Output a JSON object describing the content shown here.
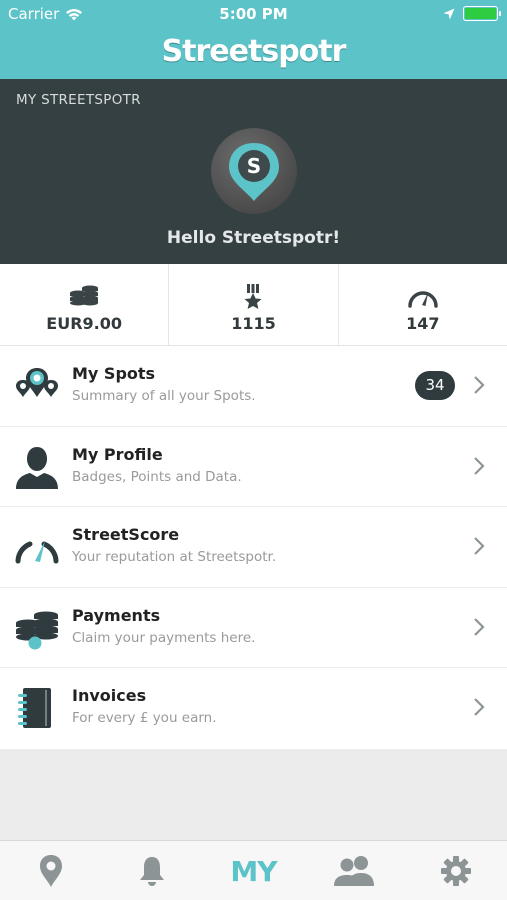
{
  "status_bar": {
    "carrier": "Carrier",
    "time": "5:00 PM"
  },
  "app": {
    "logo_text": "Streetspotr"
  },
  "profile": {
    "section_title": "MY STREETSPOTR",
    "greeting": "Hello Streetspotr!"
  },
  "stats": [
    {
      "icon": "coins-icon",
      "value": "EUR9.00"
    },
    {
      "icon": "medal-icon",
      "value": "1115"
    },
    {
      "icon": "speedometer-icon",
      "value": "147"
    }
  ],
  "menu": [
    {
      "icon": "map-pins-icon",
      "title": "My Spots",
      "subtitle": "Summary of all your Spots.",
      "badge": "34"
    },
    {
      "icon": "person-icon",
      "title": "My Profile",
      "subtitle": "Badges, Points and Data."
    },
    {
      "icon": "speedometer-icon",
      "title": "StreetScore",
      "subtitle": "Your reputation at Streetspotr."
    },
    {
      "icon": "coins-icon",
      "title": "Payments",
      "subtitle": "Claim your payments here."
    },
    {
      "icon": "notebook-icon",
      "title": "Invoices",
      "subtitle": "For every £ you earn."
    }
  ],
  "tabbar": {
    "active": "my",
    "my_label": "MY",
    "tabs": [
      "map-pin-icon",
      "bell-icon",
      "my-tab",
      "people-icon",
      "gear-icon"
    ]
  },
  "colors": {
    "accent": "#5cc3c8",
    "dark_band": "#354043",
    "badge": "#2f3b3e"
  }
}
